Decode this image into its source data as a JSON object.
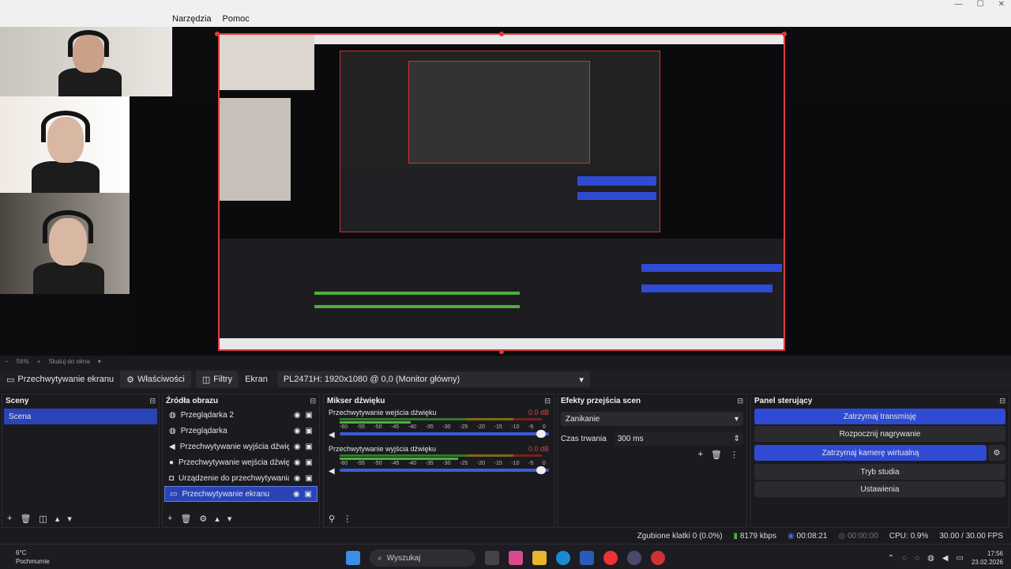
{
  "menu": [
    "Narzędzia",
    "Pomoc"
  ],
  "zoom": {
    "percent": "56%",
    "fit_label": "Skaluj do okna"
  },
  "source_toolbar": {
    "current_source": "Przechwytywanie ekranu",
    "properties": "Właściwości",
    "filters": "Filtry",
    "screen_label": "Ekran",
    "screen_value": "PL2471H: 1920x1080 @ 0,0 (Monitor główny)"
  },
  "docks": {
    "scenes": {
      "title": "Sceny",
      "items": [
        "Scena"
      ]
    },
    "sources": {
      "title": "Źródła obrazu",
      "items": [
        {
          "name": "Przeglądarka 2",
          "icon": "globe-icon"
        },
        {
          "name": "Przeglądarka",
          "icon": "globe-icon"
        },
        {
          "name": "Przechwytywanie wyjścia dźwięku",
          "icon": "speaker-icon"
        },
        {
          "name": "Przechwytywanie wejścia dźwięku",
          "icon": "mic-icon"
        },
        {
          "name": "Urządzenie do przechwytywania wi",
          "icon": "camera-icon"
        },
        {
          "name": "Przechwytywanie ekranu",
          "icon": "monitor-icon"
        }
      ]
    },
    "mixer": {
      "title": "Mikser dźwięku",
      "channels": [
        {
          "name": "Przechwytywanie wejścia dźwięku",
          "db": "0.0 dB"
        },
        {
          "name": "Przechwytywanie wyjścia dźwięku",
          "db": "0.0 dB"
        }
      ],
      "scale": [
        "-60",
        "-55",
        "-50",
        "-45",
        "-40",
        "-35",
        "-30",
        "-25",
        "-20",
        "-15",
        "-10",
        "-5",
        "0"
      ]
    },
    "transitions": {
      "title": "Efekty przejścia scen",
      "selected": "Zanikanie",
      "duration_label": "Czas trwania",
      "duration_value": "300 ms"
    },
    "controls": {
      "title": "Panel sterujący",
      "buttons": [
        "Zatrzymaj transmisję",
        "Rozpocznij nagrywanie",
        "Zatrzymaj kamerę wirtualną",
        "Tryb studia",
        "Ustawienia"
      ]
    }
  },
  "status": {
    "dropped": "Zgubione klatki 0 (0.0%)",
    "bitrate": "8179 kbps",
    "stream_time": "00:08:21",
    "rec_time": "00:00:00",
    "cpu": "CPU: 0.9%",
    "fps": "30.00 / 30.00 FPS"
  },
  "taskbar": {
    "temp": "6°C",
    "weather": "Pochmurnie",
    "search": "Wyszukaj",
    "time": "17:56",
    "date": "23.02.2026"
  },
  "colors": {
    "accent": "#2f4bd3",
    "preview_border": "#e23a3a",
    "meter_green": "#4caf3a"
  }
}
